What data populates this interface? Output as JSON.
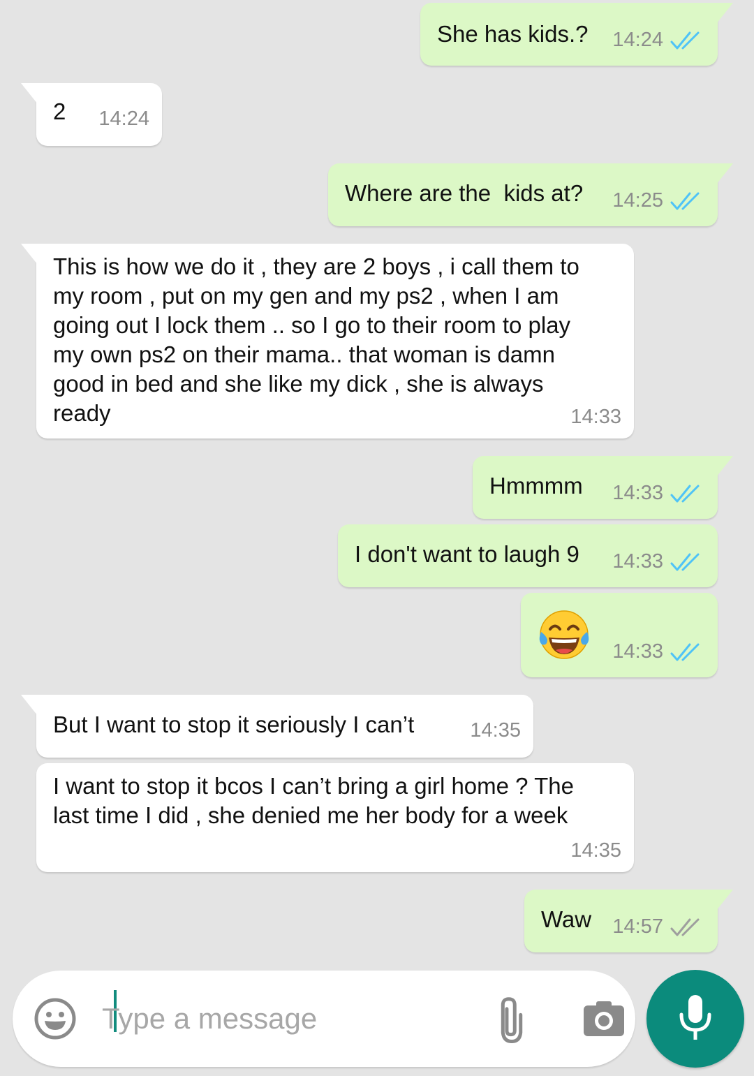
{
  "messages": [
    {
      "direction": "out",
      "text": "She has kids.?",
      "time": "14:24",
      "status": "read"
    },
    {
      "direction": "in",
      "text": "2",
      "time": "14:24"
    },
    {
      "direction": "out",
      "text": "Where are the  kids at?",
      "time": "14:25",
      "status": "read"
    },
    {
      "direction": "in",
      "text": "This is how we do it , they are 2 boys , i call them to\nmy room , put on my gen and my ps2 , when I am\ngoing out I lock them .. so I go to their room to play\nmy own ps2 on their mama.. that woman is damn\ngood in bed and she like my dick , she is always\nready",
      "time": "14:33"
    },
    {
      "direction": "out",
      "text": "Hmmmm",
      "time": "14:33",
      "status": "read"
    },
    {
      "direction": "out",
      "text": "I don't want to laugh 9",
      "time": "14:33",
      "status": "read"
    },
    {
      "direction": "out",
      "emoji": "face-with-tears-of-joy",
      "time": "14:33",
      "status": "read"
    },
    {
      "direction": "in",
      "text": "But I want to stop it seriously I can’t",
      "time": "14:35"
    },
    {
      "direction": "in",
      "text": "I want to stop it bcos I can’t bring a girl home ? The\nlast time I did , she denied me her body for a week",
      "time": "14:35"
    },
    {
      "direction": "out",
      "text": "Waw",
      "time": "14:57",
      "status": "delivered"
    }
  ],
  "composer": {
    "placeholder": "Type a message",
    "value": ""
  },
  "icons": {
    "emoji_button": "smiley-icon",
    "attach_button": "paperclip-icon",
    "camera_button": "camera-icon",
    "mic_button": "microphone-icon"
  },
  "colors": {
    "background": "#e4e4e4",
    "outgoing_bubble": "#dcf8c6",
    "incoming_bubble": "#ffffff",
    "read_ticks": "#4fc3f7",
    "delivered_ticks": "#9e9e9e",
    "accent": "#0b8b7c"
  }
}
